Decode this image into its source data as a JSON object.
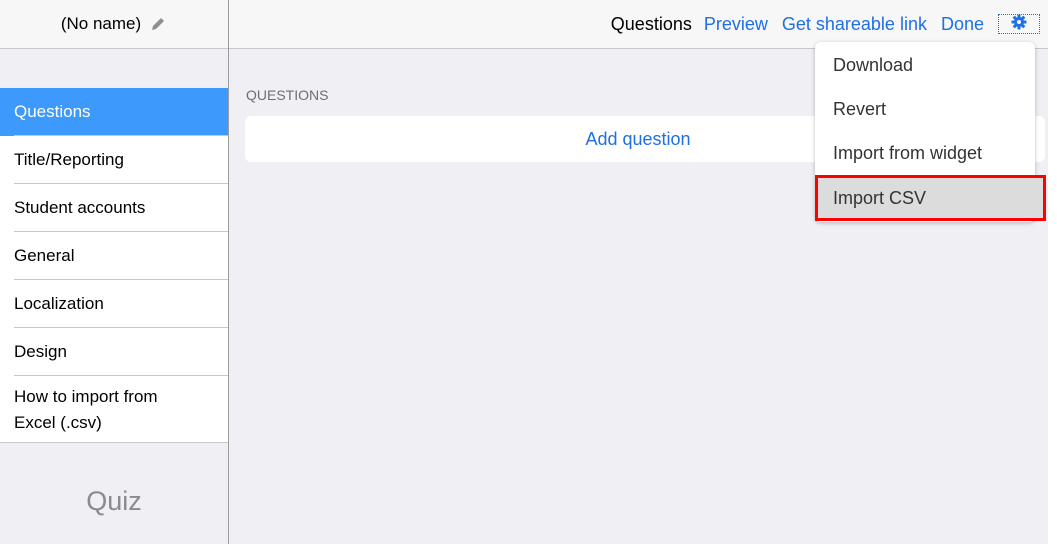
{
  "sidebar": {
    "title": "(No name)",
    "items": [
      {
        "label": "Questions",
        "active": true
      },
      {
        "label": "Title/Reporting"
      },
      {
        "label": "Student accounts"
      },
      {
        "label": "General"
      },
      {
        "label": "Localization"
      },
      {
        "label": "Design"
      },
      {
        "label": "How to import from Excel (.csv)"
      }
    ],
    "footer": "Quiz"
  },
  "topbar": {
    "current": "Questions",
    "links": [
      "Preview",
      "Get shareable link",
      "Done"
    ],
    "settings_icon": "gear-icon"
  },
  "main": {
    "section_label": "QUESTIONS",
    "add_question": "Add question"
  },
  "dropdown": {
    "items": [
      "Download",
      "Revert",
      "Import from widget",
      "Import CSV"
    ],
    "highlighted": "Import CSV"
  },
  "colors": {
    "accent": "#1f6fe5",
    "active_nav": "#3d99fb",
    "highlight_border": "#ff0000"
  }
}
